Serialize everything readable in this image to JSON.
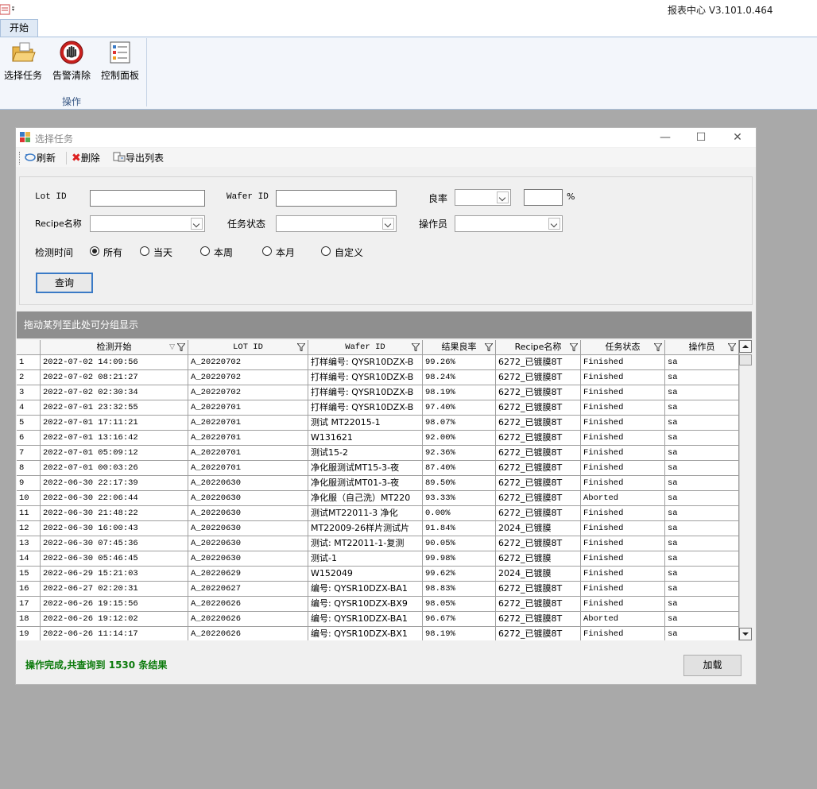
{
  "app": {
    "title": "报表中心 V3.101.0.464"
  },
  "ribbon": {
    "tab": "开始",
    "buttons": [
      {
        "label": "选择任务",
        "icon": "folder-icon"
      },
      {
        "label": "告警清除",
        "icon": "stop-hand-icon"
      },
      {
        "label": "控制面板",
        "icon": "control-panel-icon"
      }
    ],
    "group_label": "操作"
  },
  "dialog": {
    "title": "选择任务",
    "toolbar": {
      "refresh": "刷新",
      "delete": "删除",
      "export": "导出列表"
    },
    "filters": {
      "lot_id_label": "Lot ID",
      "lot_id_value": "",
      "wafer_id_label": "Wafer ID",
      "wafer_id_value": "",
      "yield_label": "良率",
      "yield_value": "",
      "yield_unit": "%",
      "recipe_label": "Recipe名称",
      "recipe_value": "",
      "task_state_label": "任务状态",
      "task_state_value": "",
      "operator_label": "操作员",
      "operator_value": "",
      "time_label": "检测时间",
      "time_options": [
        "所有",
        "当天",
        "本周",
        "本月",
        "自定义"
      ],
      "time_selected": "所有",
      "query_button": "查询"
    },
    "group_hint": "拖动某列至此处可分组显示",
    "grid": {
      "columns": [
        "检测开始",
        "LOT ID",
        "Wafer ID",
        "结果良率",
        "Recipe名称",
        "任务状态",
        "操作员"
      ],
      "rows": [
        {
          "n": "1",
          "start": "2022-07-02 14:09:56",
          "lot": "A_20220702",
          "wafer": "打样编号: QYSR10DZX-B",
          "yield": "99.26%",
          "recipe": "6272_已镀膜8T",
          "state": "Finished",
          "op": "sa"
        },
        {
          "n": "2",
          "start": "2022-07-02 08:21:27",
          "lot": "A_20220702",
          "wafer": "打样编号: QYSR10DZX-B",
          "yield": "98.24%",
          "recipe": "6272_已镀膜8T",
          "state": "Finished",
          "op": "sa"
        },
        {
          "n": "3",
          "start": "2022-07-02 02:30:34",
          "lot": "A_20220702",
          "wafer": "打样编号: QYSR10DZX-B",
          "yield": "98.19%",
          "recipe": "6272_已镀膜8T",
          "state": "Finished",
          "op": "sa"
        },
        {
          "n": "4",
          "start": "2022-07-01 23:32:55",
          "lot": "A_20220701",
          "wafer": "打样编号: QYSR10DZX-B",
          "yield": "97.40%",
          "recipe": "6272_已镀膜8T",
          "state": "Finished",
          "op": "sa"
        },
        {
          "n": "5",
          "start": "2022-07-01 17:11:21",
          "lot": "A_20220701",
          "wafer": "测试 MT22015-1",
          "yield": "98.07%",
          "recipe": "6272_已镀膜8T",
          "state": "Finished",
          "op": "sa"
        },
        {
          "n": "6",
          "start": "2022-07-01 13:16:42",
          "lot": "A_20220701",
          "wafer": "W131621",
          "yield": "92.00%",
          "recipe": "6272_已镀膜8T",
          "state": "Finished",
          "op": "sa"
        },
        {
          "n": "7",
          "start": "2022-07-01 05:09:12",
          "lot": "A_20220701",
          "wafer": "测试15-2",
          "yield": "92.36%",
          "recipe": "6272_已镀膜8T",
          "state": "Finished",
          "op": "sa"
        },
        {
          "n": "8",
          "start": "2022-07-01 00:03:26",
          "lot": "A_20220701",
          "wafer": "净化服测试MT15-3-夜",
          "yield": "87.40%",
          "recipe": "6272_已镀膜8T",
          "state": "Finished",
          "op": "sa"
        },
        {
          "n": "9",
          "start": "2022-06-30 22:17:39",
          "lot": "A_20220630",
          "wafer": "净化服测试MT01-3-夜",
          "yield": "89.50%",
          "recipe": "6272_已镀膜8T",
          "state": "Finished",
          "op": "sa"
        },
        {
          "n": "10",
          "start": "2022-06-30 22:06:44",
          "lot": "A_20220630",
          "wafer": "净化服（自己洗）MT220",
          "yield": "93.33%",
          "recipe": "6272_已镀膜8T",
          "state": "Aborted",
          "op": "sa"
        },
        {
          "n": "11",
          "start": "2022-06-30 21:48:22",
          "lot": "A_20220630",
          "wafer": "测试MT22011-3  净化",
          "yield": "0.00%",
          "recipe": "6272_已镀膜8T",
          "state": "Finished",
          "op": "sa"
        },
        {
          "n": "12",
          "start": "2022-06-30 16:00:43",
          "lot": "A_20220630",
          "wafer": "MT22009-26样片测试片",
          "yield": "91.84%",
          "recipe": "2024_已镀膜",
          "state": "Finished",
          "op": "sa"
        },
        {
          "n": "13",
          "start": "2022-06-30 07:45:36",
          "lot": "A_20220630",
          "wafer": "测试: MT22011-1-复测",
          "yield": "90.05%",
          "recipe": "6272_已镀膜8T",
          "state": "Finished",
          "op": "sa"
        },
        {
          "n": "14",
          "start": "2022-06-30 05:46:45",
          "lot": "A_20220630",
          "wafer": "测试-1",
          "yield": "99.98%",
          "recipe": "6272_已镀膜",
          "state": "Finished",
          "op": "sa"
        },
        {
          "n": "15",
          "start": "2022-06-29 15:21:03",
          "lot": "A_20220629",
          "wafer": "W152049",
          "yield": "99.62%",
          "recipe": "2024_已镀膜",
          "state": "Finished",
          "op": "sa"
        },
        {
          "n": "16",
          "start": "2022-06-27 02:20:31",
          "lot": "A_20220627",
          "wafer": "编号: QYSR10DZX-BA1",
          "yield": "98.83%",
          "recipe": "6272_已镀膜8T",
          "state": "Finished",
          "op": "sa"
        },
        {
          "n": "17",
          "start": "2022-06-26 19:15:56",
          "lot": "A_20220626",
          "wafer": "编号: QYSR10DZX-BX9",
          "yield": "98.05%",
          "recipe": "6272_已镀膜8T",
          "state": "Finished",
          "op": "sa"
        },
        {
          "n": "18",
          "start": "2022-06-26 19:12:02",
          "lot": "A_20220626",
          "wafer": "编号: QYSR10DZX-BA1",
          "yield": "96.67%",
          "recipe": "6272_已镀膜8T",
          "state": "Aborted",
          "op": "sa"
        },
        {
          "n": "19",
          "start": "2022-06-26 11:14:17",
          "lot": "A_20220626",
          "wafer": "编号: QYSR10DZX-BX1",
          "yield": "98.19%",
          "recipe": "6272_已镀膜8T",
          "state": "Finished",
          "op": "sa"
        }
      ]
    },
    "status": "操作完成,共查询到 1530 条结果",
    "load_button": "加载"
  }
}
